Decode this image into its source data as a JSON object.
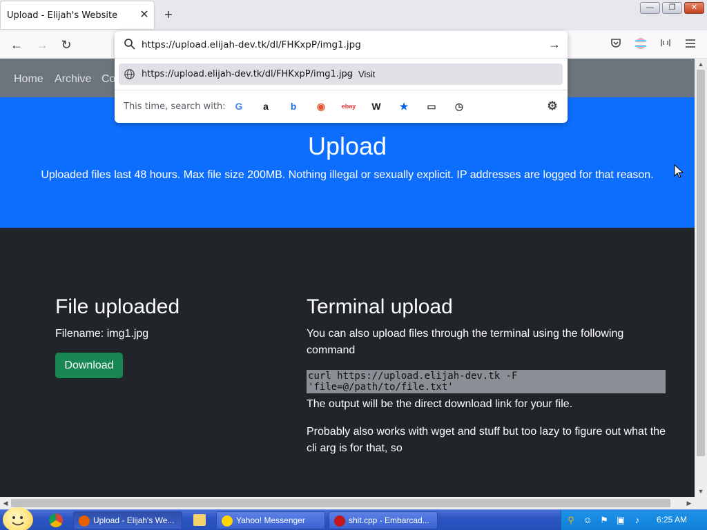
{
  "browser": {
    "tab_title": "Upload - Elijah's Website",
    "tab_close": "✕",
    "new_tab": "+",
    "window_buttons": [
      "—",
      "❐",
      "✕"
    ],
    "nav": {
      "back": "←",
      "forward": "→",
      "reload": "↻"
    }
  },
  "address_bar": {
    "url": "https://upload.elijah-dev.tk/dl/FHKxpP/img1.jpg",
    "go": "→",
    "suggestion": {
      "url": "https://upload.elijah-dev.tk/dl/FHKxpP/img1.jpg",
      "dash": "—",
      "action": "Visit"
    },
    "search_with_label": "This time, search with:",
    "engines": [
      {
        "name": "google",
        "glyph": "G",
        "color": "#4285f4"
      },
      {
        "name": "amazon",
        "glyph": "a",
        "color": "#111111"
      },
      {
        "name": "bing",
        "glyph": "b",
        "color": "#1a73e8"
      },
      {
        "name": "duckduckgo",
        "glyph": "◉",
        "color": "#de5833"
      },
      {
        "name": "ebay",
        "glyph": "ebay",
        "color": "#e53238"
      },
      {
        "name": "wikipedia",
        "glyph": "W",
        "color": "#222222"
      },
      {
        "name": "bookmarks",
        "glyph": "★",
        "color": "#0060df"
      },
      {
        "name": "tabs",
        "glyph": "▭",
        "color": "#444444"
      },
      {
        "name": "history",
        "glyph": "◷",
        "color": "#444444"
      }
    ],
    "settings_glyph": "⚙"
  },
  "site_nav": {
    "items": [
      "Home",
      "Archive",
      "Co"
    ]
  },
  "hero": {
    "title": "Upload",
    "subtitle": "Uploaded files last 48 hours. Max file size 200MB. Nothing illegal or sexually explicit. IP addresses are logged for that reason."
  },
  "file_section": {
    "heading": "File uploaded",
    "filename_line": "Filename: img1.jpg",
    "download_label": "Download"
  },
  "terminal_section": {
    "heading": "Terminal upload",
    "intro": "You can also upload files through the terminal using the following command",
    "command": "curl https://upload.elijah-dev.tk -F 'file=@/path/to/file.txt'",
    "output_note": "The output will be the direct download link for your file.",
    "extra_note": "Probably also works with wget and stuff but too lazy to figure out what the cli arg is for that, so"
  },
  "taskbar": {
    "buttons": [
      {
        "label": "Upload - Elijah's We...",
        "icon_color": "#e66000"
      },
      {
        "label": "Yahoo! Messenger",
        "icon_color": "#ffd400"
      },
      {
        "label": "shit.cpp - Embarcad...",
        "icon_color": "#c4161c"
      }
    ],
    "clock": "6:25 AM"
  },
  "colors": {
    "hero_blue": "#0d6efd",
    "page_dark": "#212529",
    "download_green": "#198754",
    "nav_gray": "#6c757d"
  }
}
